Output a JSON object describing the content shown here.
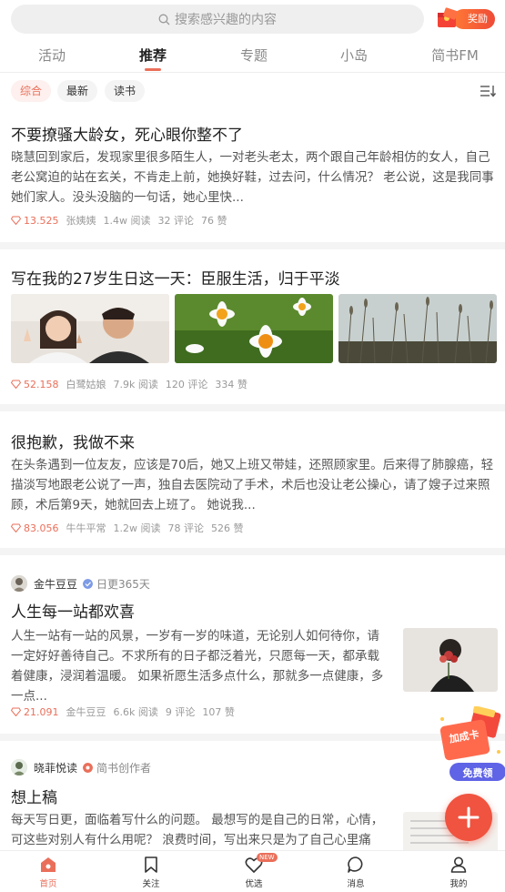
{
  "search": {
    "placeholder": "搜索感兴趣的内容"
  },
  "reward": {
    "label": "奖励"
  },
  "tabs": [
    {
      "label": "活动"
    },
    {
      "label": "推荐"
    },
    {
      "label": "专题"
    },
    {
      "label": "小岛"
    },
    {
      "label": "简书FM"
    }
  ],
  "active_tab": "推荐",
  "filters": [
    {
      "label": "综合"
    },
    {
      "label": "最新"
    },
    {
      "label": "读书"
    }
  ],
  "sort_icon": "sort-list-icon",
  "articles": [
    {
      "title": "不要撩骚大龄女，死心眼你整不了",
      "excerpt": "晓慧回到家后，发现家里很多陌生人，一对老头老太，两个跟自己年龄相仿的女人，自己老公窝迫的站在玄关，不肯走上前，她换好鞋，过去问，什么情况？ 老公说，这是我同事她们家人。没头没脑的一句话，她心里快...",
      "diamonds": "13.525",
      "author": "张姨姨",
      "reads": "1.4w 阅读",
      "comments": "32 评论",
      "likes": "76 赞"
    },
    {
      "title": "写在我的27岁生日这一天：臣服生活，归于平淡",
      "diamonds": "52.158",
      "author": "白鹭姑娘",
      "reads": "7.9k 阅读",
      "comments": "120 评论",
      "likes": "334 赞"
    },
    {
      "title": "很抱歉，我做不来",
      "excerpt": "在头条遇到一位友友，应该是70后，她又上班又带娃，还照顾家里。后来得了肺腺癌，轻描淡写地跟老公说了一声，独自去医院动了手术，术后也没让老公操心，请了嫂子过来照顾，术后第9天，她就回去上班了。 她说我...",
      "diamonds": "83.056",
      "author": "牛牛平常",
      "reads": "1.2w 阅读",
      "comments": "78 评论",
      "likes": "526 赞"
    },
    {
      "author_name": "金牛豆豆",
      "author_sub": "日更365天",
      "title": "人生每一站都欢喜",
      "excerpt": "人生一站有一站的风景，一岁有一岁的味道，无论别人如何待你，请一定好好善待自己。不求所有的日子都泛着光，只愿每一天，都承载着健康，浸润着温暖。 如果祈愿生活多点什么，那就多一点健康，多一点...",
      "diamonds": "21.091",
      "author": "金牛豆豆",
      "reads": "6.6k 阅读",
      "comments": "9 评论",
      "likes": "107 赞"
    },
    {
      "author_name": "晓菲悦读",
      "author_sub": "简书创作者",
      "title": "想上稿",
      "excerpt": "每天写日更，面临着写什么的问题。 最想写的是自己的日常，心情，可这些对别人有什么用呢？ 浪费时间，写出来只是为了自己心里痛快？ 我"
    }
  ],
  "coupon": {
    "title": "加成卡",
    "button": "免费领"
  },
  "fab_icon": "plus-icon",
  "bottom_nav": [
    {
      "label": "首页",
      "icon": "home-icon"
    },
    {
      "label": "关注",
      "icon": "bookmark-icon"
    },
    {
      "label": "优选",
      "icon": "heart-icon",
      "tag": "NEW"
    },
    {
      "label": "消息",
      "icon": "message-icon"
    },
    {
      "label": "我的",
      "icon": "profile-icon"
    }
  ],
  "colors": {
    "accent": "#ea6f5a",
    "fab": "#f0533f",
    "divider": "#f4f4f4"
  }
}
